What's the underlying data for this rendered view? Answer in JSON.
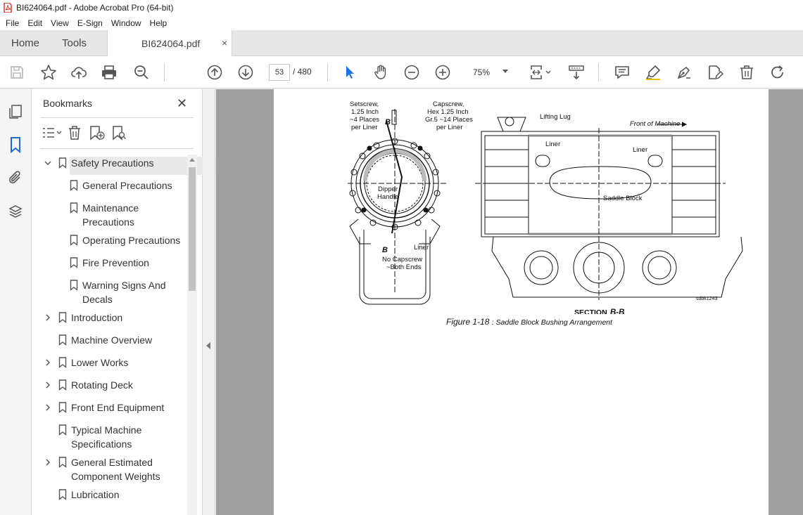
{
  "window": {
    "title": "BI624064.pdf - Adobe Acrobat Pro (64-bit)"
  },
  "menu": [
    "File",
    "Edit",
    "View",
    "E-Sign",
    "Window",
    "Help"
  ],
  "tabs": {
    "home": "Home",
    "tools": "Tools",
    "document": "BI624064.pdf",
    "close": "×"
  },
  "toolbar": {
    "current_page": "53",
    "total_pages": "/ 480",
    "zoom": "75%"
  },
  "bookmarks": {
    "title": "Bookmarks",
    "close": "✕",
    "items": [
      {
        "label": "Safety Precautions",
        "level": 0,
        "expanded": true,
        "selected": true
      },
      {
        "label": "General Precautions",
        "level": 1
      },
      {
        "label": "Maintenance\nPrecautions",
        "level": 1
      },
      {
        "label": "Operating Precautions",
        "level": 1
      },
      {
        "label": "Fire Prevention",
        "level": 1
      },
      {
        "label": "Warning Signs And\nDecals",
        "level": 1
      },
      {
        "label": "Introduction",
        "level": 0,
        "expandable": true
      },
      {
        "label": "Machine Overview",
        "level": 0
      },
      {
        "label": "Lower Works",
        "level": 0,
        "expandable": true
      },
      {
        "label": "Rotating Deck",
        "level": 0,
        "expandable": true
      },
      {
        "label": "Front End Equipment",
        "level": 0,
        "expandable": true
      },
      {
        "label": "Typical Machine\nSpecifications",
        "level": 0
      },
      {
        "label": "General Estimated\nComponent Weights",
        "level": 0,
        "expandable": true
      },
      {
        "label": "Lubrication",
        "level": 0
      }
    ]
  },
  "figure": {
    "labels": {
      "setscrew": [
        "Setscrew,",
        "1.25 Inch",
        "~4 Places",
        "per Liner"
      ],
      "capscrew": [
        "Capscrew,",
        "Hex 1.25 Inch",
        "Gr.5 ~14 Places",
        "per Liner"
      ],
      "dipper": [
        "Dipper",
        "Handle"
      ],
      "liner": "Liner",
      "no_capscrew": [
        "No Capscrew",
        "~Both Ends"
      ],
      "section_b": "B",
      "lifting_lug": "Lifting Lug",
      "front": "Front of Machine",
      "saddle_block": "Saddle Block",
      "section": "SECTION ",
      "section_id": "B-B",
      "drawing_id": "sdbk1243"
    },
    "caption_num": "Figure 1-18 ",
    "caption_text": ": Saddle Block Bushing Arrangement"
  }
}
